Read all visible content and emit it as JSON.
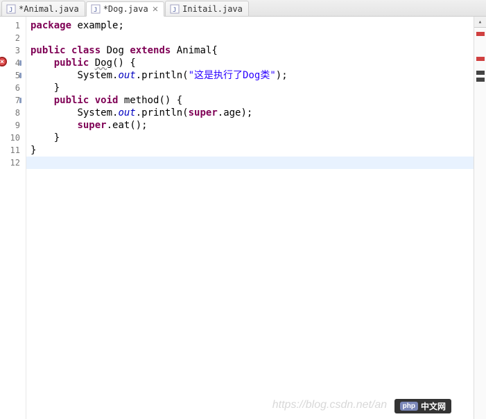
{
  "tabs": [
    {
      "label": "*Animal.java",
      "active": false,
      "closeable": false
    },
    {
      "label": "*Dog.java",
      "active": true,
      "closeable": true
    },
    {
      "label": "Initail.java",
      "active": false,
      "closeable": false
    }
  ],
  "line_numbers": [
    "1",
    "2",
    "3",
    "4",
    "5",
    "6",
    "7",
    "8",
    "9",
    "10",
    "11",
    "12"
  ],
  "code": {
    "l1": {
      "kw1": "package",
      "t1": " example;"
    },
    "l3": {
      "kw1": "public",
      "kw2": "class",
      "t1": " Dog ",
      "kw3": "extends",
      "t2": " Animal{"
    },
    "l4": {
      "indent": "    ",
      "kw1": "public",
      "t1": " ",
      "name": "Dog",
      "t2": "() {"
    },
    "l5": {
      "indent": "        ",
      "t1": "System.",
      "field": "out",
      "t2": ".println(",
      "str": "\"这是执行了Dog类\"",
      "t3": ");"
    },
    "l6": {
      "indent": "    ",
      "t1": "}"
    },
    "l7": {
      "indent": "    ",
      "kw1": "public",
      "kw2": "void",
      "t1": " method() {"
    },
    "l8": {
      "indent": "        ",
      "t1": "System.",
      "field": "out",
      "t2": ".println(",
      "kw1": "super",
      "t3": ".age);"
    },
    "l9": {
      "indent": "        ",
      "kw1": "super",
      "t1": ".eat();"
    },
    "l10": {
      "indent": "    ",
      "t1": "}"
    },
    "l11": {
      "t1": "}"
    }
  },
  "watermark": {
    "url": "https://blog.csdn.net/an",
    "brand_php": "php",
    "brand_cn": "中文网"
  }
}
